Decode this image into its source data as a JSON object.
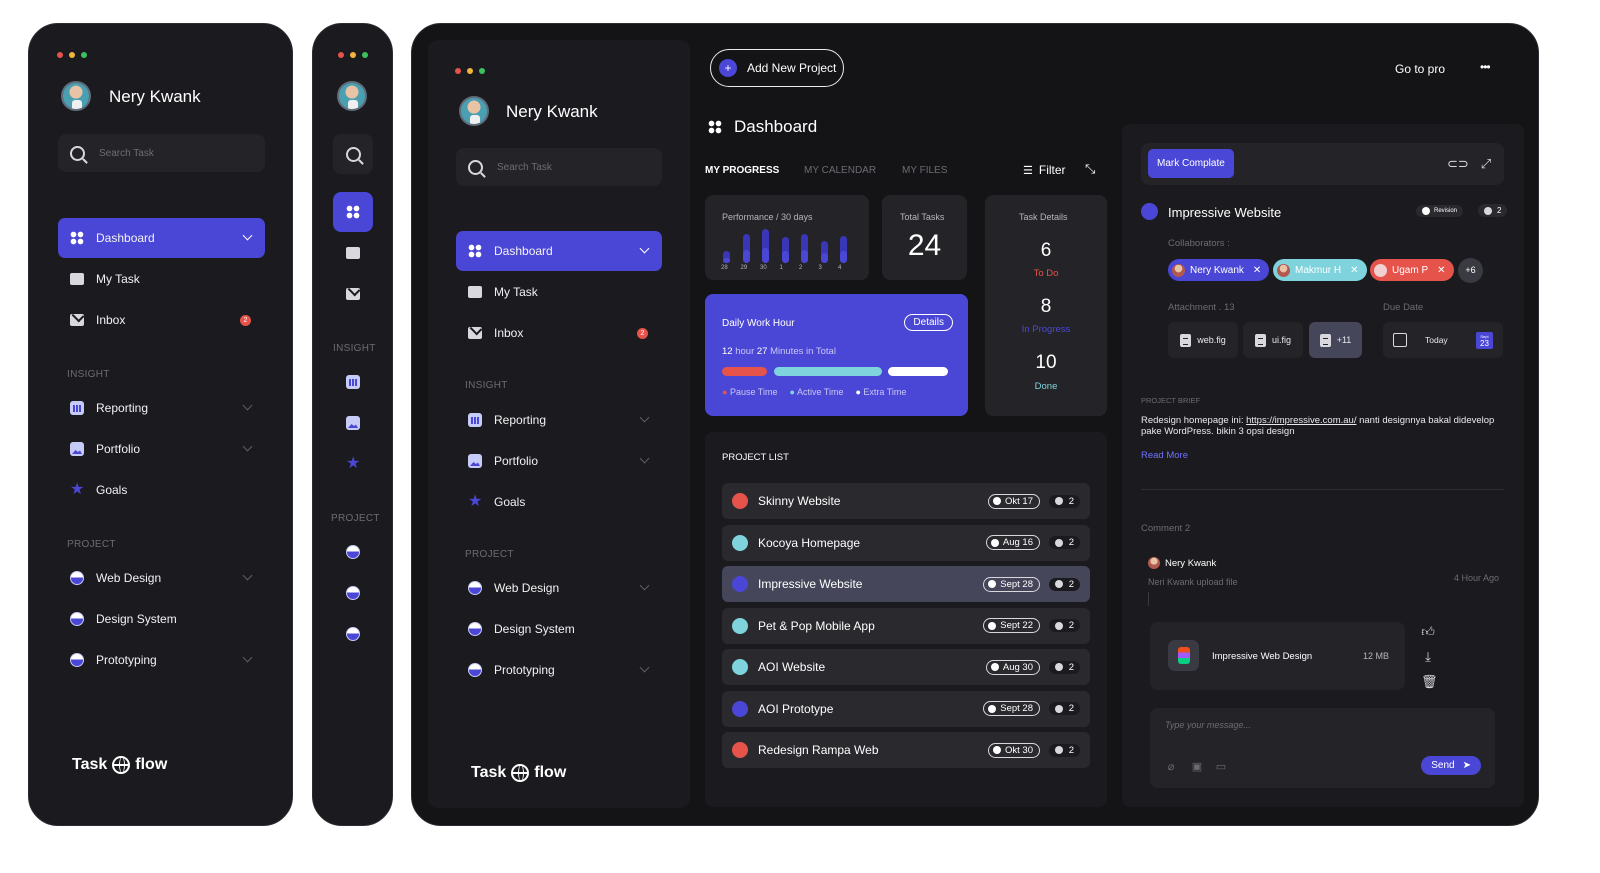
{
  "colors": {
    "accent": "#4b47d6",
    "panel": "#1b1b1f",
    "red": "#e5534b",
    "cyan": "#7fd3dc"
  },
  "user": {
    "name": "Nery Kwank"
  },
  "search": {
    "placeholder": "Search Task"
  },
  "nav": {
    "dashboard": "Dashboard",
    "mytask": "My Task",
    "inbox": "Inbox",
    "inbox_badge": "2",
    "insight_title": "INSIGHT",
    "reporting": "Reporting",
    "portfolio": "Portfolio",
    "goals": "Goals",
    "project_title": "PROJECT",
    "web_design": "Web Design",
    "design_system": "Design System",
    "prototyping": "Prototyping"
  },
  "logo": {
    "left": "Task",
    "right": "flow"
  },
  "header": {
    "add_project": "Add New Project",
    "go_pro": "Go to pro",
    "more": "•••",
    "title": "Dashboard"
  },
  "tabs": {
    "progress": "MY PROGRESS",
    "calendar": "MY CALENDAR",
    "files": "MY FILES",
    "filter": "Filter"
  },
  "performance": {
    "title": "Performance / 30 days",
    "days": [
      "28",
      "29",
      "30",
      "1",
      "2",
      "3",
      "4"
    ],
    "levels": [
      0.35,
      0.85,
      1.0,
      0.75,
      0.85,
      0.65,
      0.8
    ]
  },
  "total_tasks": {
    "label": "Total Tasks",
    "value": "24"
  },
  "task_details": {
    "label": "Task Details",
    "todo_value": "6",
    "todo_label": "To Do",
    "progress_value": "8",
    "progress_label": "In Progress",
    "done_value": "10",
    "done_label": "Done"
  },
  "work_hour": {
    "title": "Daily Work Hour",
    "details": "Details",
    "hours": "12",
    "hour_word": "hour",
    "minutes": "27",
    "minutes_word": "Minutes in Total",
    "pause": "Pause Time",
    "active": "Active Time",
    "extra": "Extra Time"
  },
  "project_list": {
    "title": "PROJECT LIST",
    "rows": [
      {
        "name": "Skinny Website",
        "date": "Okt 17",
        "comments": "2",
        "color": "#e5534b"
      },
      {
        "name": "Kocoya Homepage",
        "date": "Aug 16",
        "comments": "2",
        "color": "#7fd3dc"
      },
      {
        "name": "Impressive Website",
        "date": "Sept 28",
        "comments": "2",
        "color": "#4b47d6"
      },
      {
        "name": "Pet & Pop Mobile App",
        "date": "Sept 22",
        "comments": "2",
        "color": "#7fd3dc"
      },
      {
        "name": "AOI Website",
        "date": "Aug 30",
        "comments": "2",
        "color": "#7fd3dc"
      },
      {
        "name": "AOI Prototype",
        "date": "Sept 28",
        "comments": "2",
        "color": "#4b47d6"
      },
      {
        "name": "Redesign Rampa Web",
        "date": "Okt 30",
        "comments": "2",
        "color": "#e5534b"
      }
    ]
  },
  "detail": {
    "mark_complete": "Mark Complate",
    "title": "Impressive Website",
    "revision": "Revision",
    "comment_count": "2",
    "collaborators_label": "Collaborators :",
    "collaborators": [
      "Nery Kwank",
      "Makmur H",
      "Ugam P"
    ],
    "more_collab": "+6",
    "attachment_label": "Attachment . 13",
    "files": [
      "web.fig",
      "ui.fig",
      "+11"
    ],
    "due_label": "Due Date",
    "due_value": "Today",
    "due_month": "Sept",
    "due_day": "23",
    "brief_label": "PROJECT BRIEF",
    "brief_pre": "Redesign homepage ini: ",
    "brief_link": "https://impressive.com.au/",
    "brief_post": " nanti designnya bakal didevelop pake WordPress. bikin 3 opsi design",
    "read_more": "Read More",
    "comments_label": "Comment 2",
    "comment_user": "Nery Kwank",
    "comment_text": "Neri Kwank upload file",
    "comment_time": "4 Hour Ago",
    "file_name": "Impressive Web Design",
    "file_size": "12 MB",
    "message_placeholder": "Type your message...",
    "send": "Send"
  }
}
